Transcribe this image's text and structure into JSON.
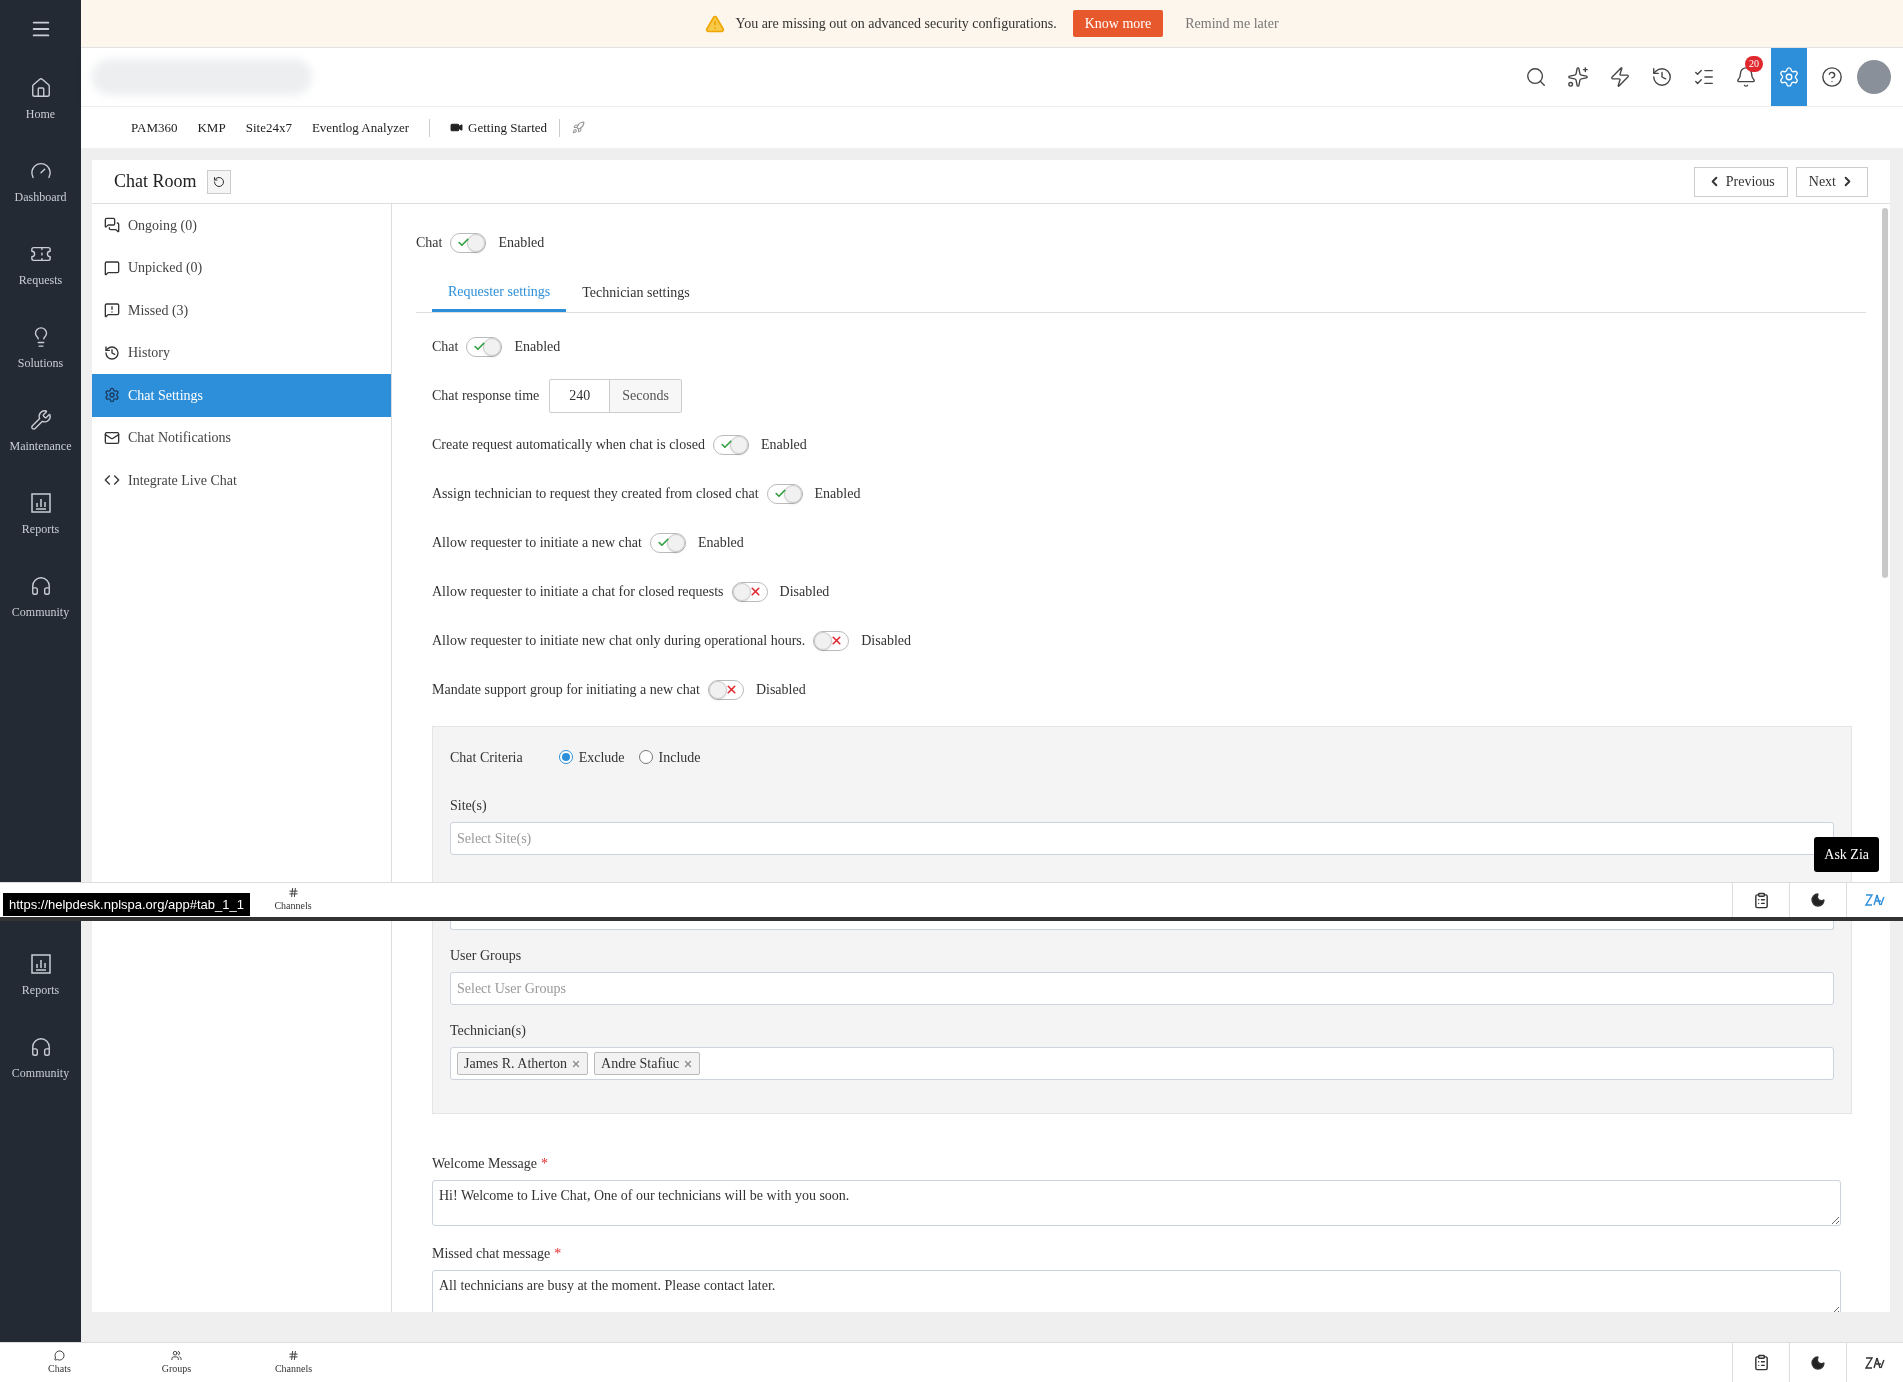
{
  "banner": {
    "message": "You are missing out on advanced security configurations.",
    "action": "Know more",
    "dismiss": "Remind me later"
  },
  "header": {
    "notification_count": "20"
  },
  "quick_links": [
    {
      "label": "PAM360",
      "kind": "text"
    },
    {
      "label": "KMP",
      "kind": "text"
    },
    {
      "label": "Site24x7",
      "kind": "text"
    },
    {
      "label": "Eventlog Analyzer",
      "kind": "text"
    },
    {
      "label": "Getting Started",
      "kind": "video"
    }
  ],
  "sidebar": {
    "items": [
      {
        "label": "Home",
        "kind": "home"
      },
      {
        "label": "Dashboard",
        "kind": "dashboard"
      },
      {
        "label": "Requests",
        "kind": "requests"
      },
      {
        "label": "Solutions",
        "kind": "solutions"
      },
      {
        "label": "Maintenance",
        "kind": "maintenance"
      },
      {
        "label": "Reports",
        "kind": "reports"
      },
      {
        "label": "Community",
        "kind": "community"
      }
    ],
    "lower_items": [
      {
        "label": "Reports",
        "kind": "reports"
      },
      {
        "label": "Community",
        "kind": "community"
      }
    ]
  },
  "page": {
    "title": "Chat Room",
    "previous": "Previous",
    "next": "Next"
  },
  "menu": [
    {
      "label": "Ongoing (0)",
      "kind": "chats",
      "selected": false
    },
    {
      "label": "Unpicked (0)",
      "kind": "chat",
      "selected": false
    },
    {
      "label": "Missed (3)",
      "kind": "missed",
      "selected": false
    },
    {
      "label": "History",
      "kind": "history",
      "selected": false
    },
    {
      "label": "Chat Settings",
      "kind": "settings",
      "selected": true
    },
    {
      "label": "Chat Notifications",
      "kind": "mail",
      "selected": false
    },
    {
      "label": "Integrate Live Chat",
      "kind": "code",
      "selected": false
    }
  ],
  "chat_toggle": {
    "label": "Chat",
    "on": true,
    "status": "Enabled"
  },
  "tabs": [
    {
      "label": "Requester settings",
      "selected": true
    },
    {
      "label": "Technician settings",
      "selected": false
    }
  ],
  "settings": [
    {
      "kind": "toggle",
      "label": "Chat",
      "on": true,
      "status": "Enabled"
    },
    {
      "kind": "number",
      "label": "Chat response time",
      "value": "240",
      "unit": "Seconds"
    },
    {
      "kind": "toggle",
      "label": "Create request automatically when chat is closed",
      "on": true,
      "status": "Enabled"
    },
    {
      "kind": "toggle",
      "label": "Assign technician to request they created from closed chat",
      "on": true,
      "status": "Enabled"
    },
    {
      "kind": "toggle",
      "label": "Allow requester to initiate a new chat",
      "on": true,
      "status": "Enabled"
    },
    {
      "kind": "toggle",
      "label": "Allow requester to initiate a chat for closed requests",
      "on": false,
      "status": "Disabled"
    },
    {
      "kind": "toggle",
      "label": "Allow requester to initiate new chat only during operational hours.",
      "on": false,
      "status": "Disabled"
    },
    {
      "kind": "toggle",
      "label": "Mandate support group for initiating a new chat",
      "on": false,
      "status": "Disabled"
    }
  ],
  "criteria": {
    "label": "Chat Criteria",
    "options": [
      {
        "label": "Exclude",
        "selected": true
      },
      {
        "label": "Include",
        "selected": false
      }
    ],
    "fields": [
      {
        "label": "Site(s)",
        "placeholder": "Select Site(s)"
      },
      {
        "label": "User Groups",
        "placeholder": "Select User Groups"
      },
      {
        "label": "Technician(s)",
        "tags": [
          "James R. Atherton",
          "Andre Stafiuc"
        ]
      }
    ]
  },
  "messages": [
    {
      "label": "Welcome Message",
      "required_mark": "*",
      "value": "Hi! Welcome to Live Chat, One of our technicians will be with you soon."
    },
    {
      "label": "Missed chat message",
      "required_mark": "*",
      "value": "All technicians are busy at the moment. Please contact later."
    }
  ],
  "overlay_strip": {
    "url": "https://helpdesk.nplspa.org/app#tab_1_1",
    "tab": "Channels",
    "tooltip": "Ask Zia"
  },
  "bottom_bar": {
    "tabs": [
      {
        "label": "Chats",
        "kind": "chats"
      },
      {
        "label": "Groups",
        "kind": "groups"
      },
      {
        "label": "Channels",
        "kind": "channels"
      }
    ]
  }
}
